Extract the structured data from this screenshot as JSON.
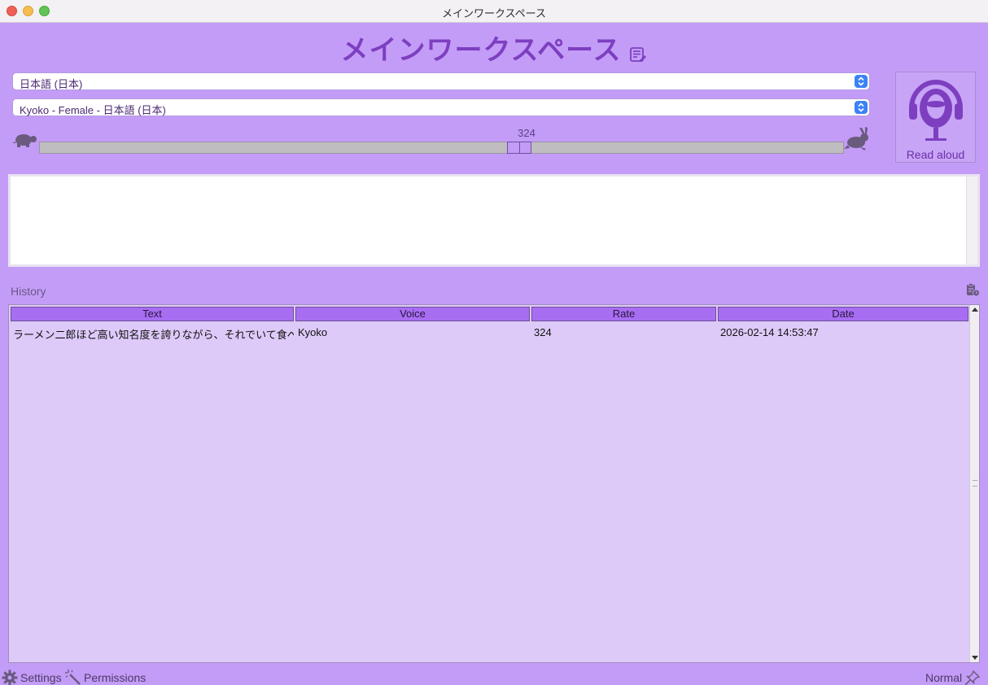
{
  "window": {
    "title": "メインワークスペース"
  },
  "header": {
    "title": "メインワークスペース",
    "icon": "note-edit-icon"
  },
  "language_select": {
    "value": "日本語 (日本)"
  },
  "voice_select": {
    "value": "Kyoko - Female - 日本語 (日本)"
  },
  "rate": {
    "value": "324",
    "fraction": 0.6
  },
  "read_button": {
    "label": "Read aloud",
    "icon": "speaker-head-icon"
  },
  "text_input": {
    "value": ""
  },
  "history": {
    "label": "History",
    "columns": [
      "Text",
      "Voice",
      "Rate",
      "Date"
    ],
    "rows": [
      {
        "text": "ラーメン二郎ほど高い知名度を誇りながら、それでいて食べる人",
        "voice": "Kyoko",
        "rate": "324",
        "date": "2026-02-14 14:53:47"
      }
    ]
  },
  "footer": {
    "settings": "Settings",
    "permissions": "Permissions",
    "mode": "Normal"
  },
  "colors": {
    "background": "#c39cf7",
    "accent": "#7d3fc0",
    "header_cell": "#a86ef2",
    "table_bg": "#decaf9"
  }
}
